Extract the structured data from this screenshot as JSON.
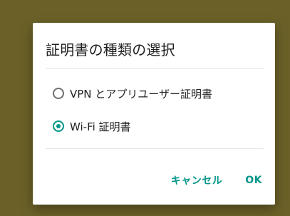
{
  "dialog": {
    "title": "証明書の種類の選択",
    "options": [
      {
        "label": "VPN とアプリユーザー証明書",
        "selected": false
      },
      {
        "label": "Wi-Fi 証明書",
        "selected": true
      }
    ],
    "buttons": {
      "cancel": "キャンセル",
      "ok": "OK"
    }
  },
  "colors": {
    "scrim": "#6b6128",
    "accent": "#009688",
    "text": "#212121",
    "radio_unselected": "#707070"
  },
  "icons": {
    "radio_unselected": "radio-unchecked-icon",
    "radio_selected": "radio-checked-icon"
  }
}
